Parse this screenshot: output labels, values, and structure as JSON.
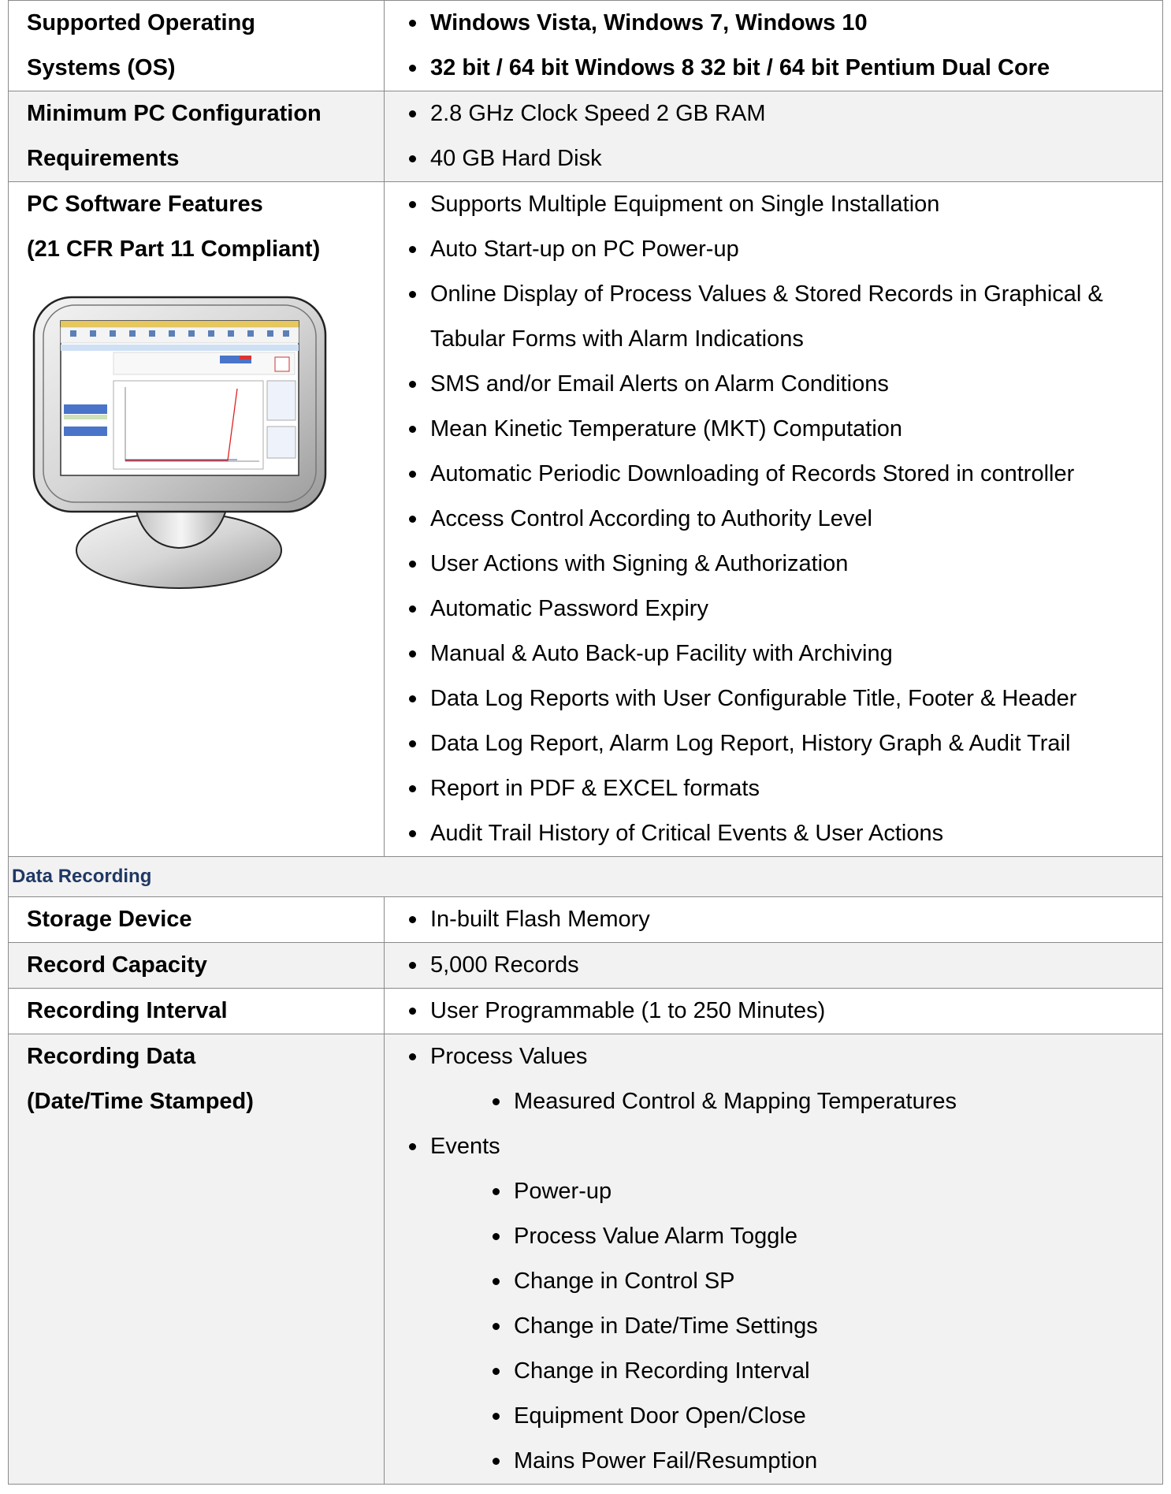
{
  "rows": {
    "os": {
      "label": [
        "Supported Operating",
        "Systems (OS)"
      ],
      "items": [
        "Windows Vista, Windows 7, Windows 10",
        "32 bit / 64 bit Windows 8 32 bit / 64 bit Pentium Dual Core"
      ]
    },
    "pc_config": {
      "label": [
        "Minimum PC Configuration",
        "Requirements"
      ],
      "items": [
        "2.8 GHz Clock Speed 2 GB RAM",
        "40 GB Hard Disk"
      ]
    },
    "software": {
      "label": [
        "PC Software Features",
        "(21 CFR Part 11 Compliant)"
      ],
      "items": [
        "Supports Multiple Equipment on Single Installation",
        "Auto Start-up on PC Power-up",
        "Online Display of Process Values & Stored Records in Graphical & Tabular Forms with Alarm Indications",
        "SMS and/or Email Alerts on Alarm Conditions",
        "Mean Kinetic Temperature (MKT) Computation",
        "Automatic Periodic Downloading of Records Stored in controller",
        "Access Control According to Authority Level",
        "User Actions with Signing & Authorization",
        "Automatic Password Expiry",
        "Manual & Auto Back-up Facility with Archiving",
        "Data Log Reports with User Configurable Title, Footer & Header",
        "Data Log Report, Alarm Log Report, History Graph & Audit Trail",
        "Report in PDF & EXCEL formats",
        "Audit Trail History of Critical Events & User Actions"
      ]
    },
    "section_title": "Data Recording",
    "storage": {
      "label": "Storage Device",
      "items": [
        "In-built Flash Memory"
      ]
    },
    "capacity": {
      "label": "Record Capacity",
      "items": [
        "5,000 Records"
      ]
    },
    "interval": {
      "label": "Recording Interval",
      "items": [
        "User Programmable (1 to 250 Minutes)"
      ]
    },
    "recording_data": {
      "label": [
        "Recording Data",
        "(Date/Time Stamped)"
      ],
      "process_values": "Process Values",
      "process_sub": [
        "Measured Control & Mapping Temperatures"
      ],
      "events": "Events",
      "events_sub": [
        "Power-up",
        "Process Value Alarm Toggle",
        "Change in Control SP",
        "Change in Date/Time Settings",
        "Change in Recording Interval",
        "Equipment Door Open/Close",
        "Mains Power Fail/Resumption"
      ]
    }
  }
}
